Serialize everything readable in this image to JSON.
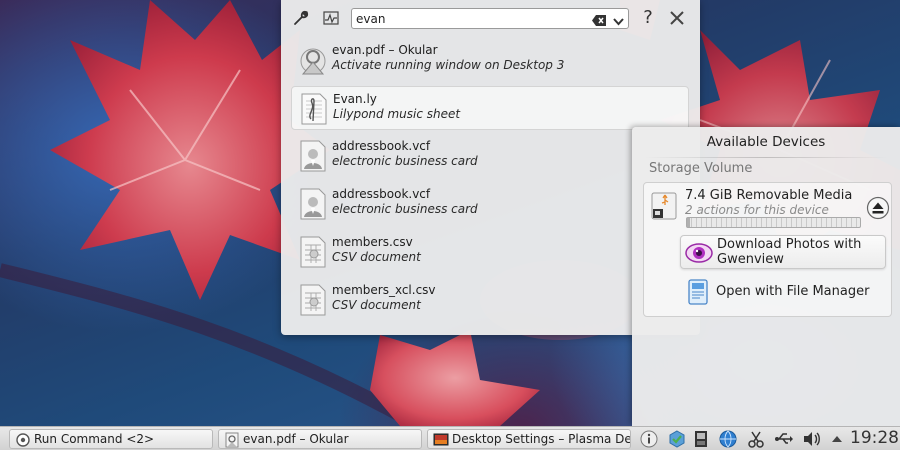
{
  "krunner": {
    "search_value": "evan",
    "help_label": "?",
    "results": [
      {
        "title": "evan.pdf – Okular",
        "subtitle": "Activate running window on Desktop 3",
        "icon": "okular-icon"
      },
      {
        "title": "Evan.ly",
        "subtitle": "Lilypond music sheet",
        "icon": "music-sheet-icon"
      },
      {
        "title": "addressbook.vcf",
        "subtitle": "electronic business card",
        "icon": "vcard-icon"
      },
      {
        "title": "addressbook.vcf",
        "subtitle": "electronic business card",
        "icon": "vcard-icon"
      },
      {
        "title": "members.csv",
        "subtitle": "CSV document",
        "icon": "spreadsheet-icon"
      },
      {
        "title": "members_xcl.csv",
        "subtitle": "CSV document",
        "icon": "spreadsheet-icon"
      }
    ],
    "selected_index": 1
  },
  "device_notifier": {
    "title": "Available Devices",
    "section": "Storage Volume",
    "device": {
      "name": "7.4 GiB Removable Media",
      "actions_text": "2 actions for this device",
      "usage_fraction": 0.02
    },
    "actions": [
      {
        "label": "Download Photos with Gwenview",
        "icon": "gwenview-icon"
      },
      {
        "label": "Open with File Manager",
        "icon": "file-manager-icon"
      }
    ]
  },
  "taskbar": {
    "tasks": [
      {
        "label": "Run Command <2>",
        "icon": "run-command-icon"
      },
      {
        "label": "evan.pdf – Okular",
        "icon": "okular-icon"
      },
      {
        "label": "Desktop Settings – Plasma Desktop Shell",
        "icon": "desktop-settings-icon"
      }
    ],
    "tray": [
      "info-icon",
      "package-updater-icon",
      "device-notifier-icon",
      "network-icon",
      "klipper-scissors-icon",
      "usb-icon",
      "volume-icon",
      "expand-arrow-icon"
    ],
    "clock": "19:28"
  },
  "colors": {
    "panel_bg": "#ececec",
    "selected_row": "#f6f6f6",
    "accent_leaf": "#d8323f"
  }
}
